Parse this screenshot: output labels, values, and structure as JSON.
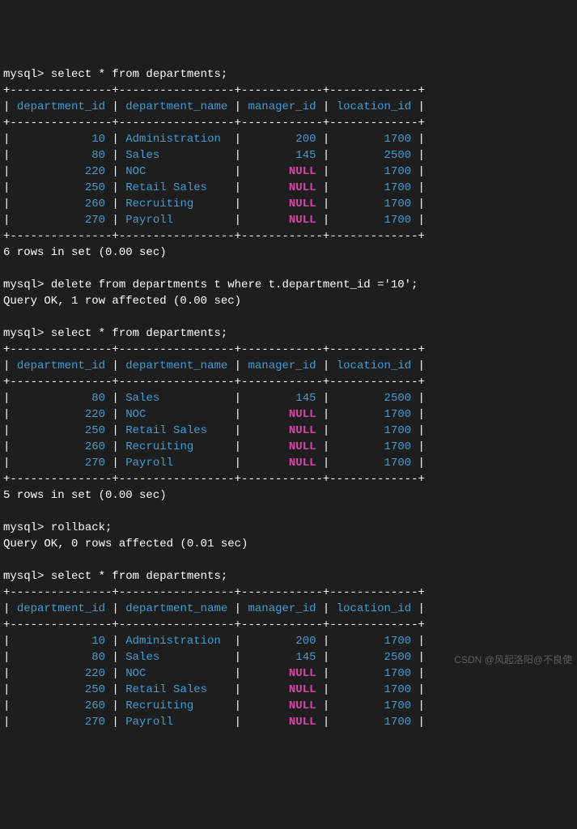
{
  "prompt": "mysql>",
  "queries": {
    "select_all": "select * from departments;",
    "delete_row": "delete from departments t where t.department_id ='10';",
    "rollback": "rollback;"
  },
  "status": {
    "rows6": "6 rows in set (0.00 sec)",
    "rows5": "5 rows in set (0.00 sec)",
    "delete_ok": "Query OK, 1 row affected (0.00 sec)",
    "rollback_ok": "Query OK, 0 rows affected (0.01 sec)"
  },
  "null_text": "NULL",
  "headers": {
    "c1": "department_id",
    "c2": "department_name",
    "c3": "manager_id",
    "c4": "location_id"
  },
  "border_line": "+---------------+-----------------+------------+-------------+",
  "table_full": [
    {
      "c1": "10",
      "c2": "Administration",
      "c3": "200",
      "c4": "1700"
    },
    {
      "c1": "80",
      "c2": "Sales",
      "c3": "145",
      "c4": "2500"
    },
    {
      "c1": "220",
      "c2": "NOC",
      "c3": null,
      "c4": "1700"
    },
    {
      "c1": "250",
      "c2": "Retail Sales",
      "c3": null,
      "c4": "1700"
    },
    {
      "c1": "260",
      "c2": "Recruiting",
      "c3": null,
      "c4": "1700"
    },
    {
      "c1": "270",
      "c2": "Payroll",
      "c3": null,
      "c4": "1700"
    }
  ],
  "table_after_delete": [
    {
      "c1": "80",
      "c2": "Sales",
      "c3": "145",
      "c4": "2500"
    },
    {
      "c1": "220",
      "c2": "NOC",
      "c3": null,
      "c4": "1700"
    },
    {
      "c1": "250",
      "c2": "Retail Sales",
      "c3": null,
      "c4": "1700"
    },
    {
      "c1": "260",
      "c2": "Recruiting",
      "c3": null,
      "c4": "1700"
    },
    {
      "c1": "270",
      "c2": "Payroll",
      "c3": null,
      "c4": "1700"
    }
  ],
  "watermark": "CSDN @风起洛阳@不良使"
}
